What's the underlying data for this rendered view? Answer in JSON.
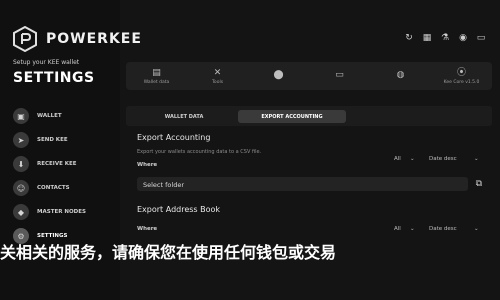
{
  "brand": {
    "name": "POWERKEE",
    "setup_text": "Setup your KEE wallet",
    "title": "SETTINGS"
  },
  "sidebar": {
    "items": [
      {
        "label": "WALLET",
        "icon": "wallet-icon",
        "glyph": "▣"
      },
      {
        "label": "SEND KEE",
        "icon": "send-icon",
        "glyph": "➤"
      },
      {
        "label": "RECEIVE KEE",
        "icon": "receive-icon",
        "glyph": "⬇"
      },
      {
        "label": "CONTACTS",
        "icon": "contacts-icon",
        "glyph": "☺"
      },
      {
        "label": "MASTER NODES",
        "icon": "nodes-icon",
        "glyph": "◆"
      },
      {
        "label": "SETTINGS",
        "icon": "settings-icon",
        "glyph": "⚙"
      }
    ]
  },
  "top_icons": [
    {
      "icon": "refresh-icon",
      "glyph": "↻"
    },
    {
      "icon": "grid-icon",
      "glyph": "▦"
    },
    {
      "icon": "flask-icon",
      "glyph": "⚗"
    },
    {
      "icon": "eye-icon",
      "glyph": "◉"
    },
    {
      "icon": "chat-icon",
      "glyph": "▭"
    }
  ],
  "tabs": [
    {
      "label": "Wallet data",
      "icon": "database-icon",
      "glyph": "▤"
    },
    {
      "label": "Tools",
      "icon": "tools-icon",
      "glyph": "✕"
    },
    {
      "label": "",
      "icon": "chart-icon",
      "glyph": "⬤"
    },
    {
      "label": "",
      "icon": "folder-tab-icon",
      "glyph": "▭"
    },
    {
      "label": "",
      "icon": "user-icon",
      "glyph": "◍"
    },
    {
      "label": "Kee Core v1.5.0",
      "icon": "core-icon",
      "glyph": "⦿"
    }
  ],
  "subtabs": {
    "first": "WALLET DATA",
    "second": "EXPORT ACCOUNTING"
  },
  "export_accounting": {
    "title": "Export Accounting",
    "description": "Export your wallets accounting data to a CSV file.",
    "where_label": "Where",
    "filter": "All",
    "sort": "Date desc",
    "field_value": "Select folder"
  },
  "export_address": {
    "title": "Export Address Book",
    "where_label": "Where",
    "filter": "All",
    "sort": "Date desc"
  },
  "overlay_text": "关相关的服务，请确保您在使用任何钱包或交易"
}
